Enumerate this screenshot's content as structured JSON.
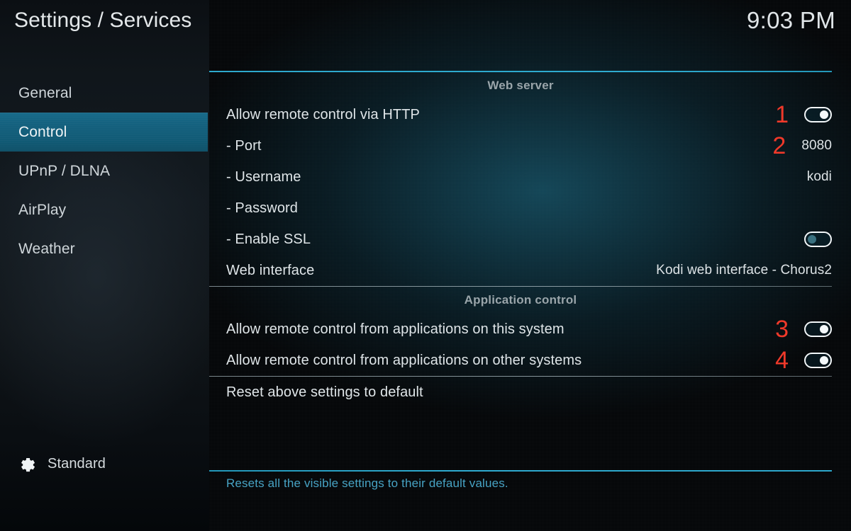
{
  "header": {
    "title": "Settings / Services",
    "clock": "9:03 PM"
  },
  "sidebar": {
    "items": [
      {
        "label": "General",
        "selected": false
      },
      {
        "label": "Control",
        "selected": true
      },
      {
        "label": "UPnP / DLNA",
        "selected": false
      },
      {
        "label": "AirPlay",
        "selected": false
      },
      {
        "label": "Weather",
        "selected": false
      }
    ],
    "profile": {
      "icon": "gear-icon",
      "label": "Standard"
    }
  },
  "main": {
    "sections": [
      {
        "header": "Web server",
        "rows": [
          {
            "label": "Allow remote control via HTTP",
            "control": "toggle",
            "state": "on",
            "marker": "1"
          },
          {
            "label": "- Port",
            "control": "value",
            "value": "8080",
            "marker": "2"
          },
          {
            "label": "- Username",
            "control": "value",
            "value": "kodi",
            "marker": ""
          },
          {
            "label": "- Password",
            "control": "value",
            "value": "",
            "marker": ""
          },
          {
            "label": "- Enable SSL",
            "control": "toggle",
            "state": "off",
            "marker": ""
          },
          {
            "label": "Web interface",
            "control": "value",
            "value": "Kodi web interface - Chorus2",
            "marker": ""
          }
        ]
      },
      {
        "header": "Application control",
        "rows": [
          {
            "label": "Allow remote control from applications on this system",
            "control": "toggle",
            "state": "on",
            "marker": "3"
          },
          {
            "label": "Allow remote control from applications on other systems",
            "control": "toggle",
            "state": "on",
            "marker": "4"
          }
        ]
      },
      {
        "header": "",
        "rows": [
          {
            "label": "Reset above settings to default",
            "control": "none",
            "value": "",
            "marker": ""
          }
        ]
      }
    ],
    "help_text": "Resets all the visible settings to their default values."
  },
  "colors": {
    "accent_line": "#2da8cc",
    "selected_row": "#14607d",
    "marker_red": "#f0392a",
    "help_blue": "#47a3c4"
  }
}
